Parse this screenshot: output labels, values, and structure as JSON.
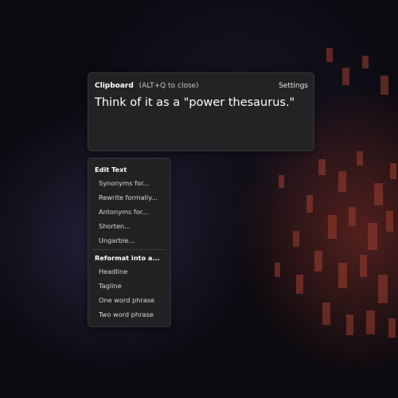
{
  "clipboard": {
    "title": "Clipboard",
    "hint": "(ALT+Q to close)",
    "settings_label": "Settings",
    "content": "Think of it as a \"power thesaurus.\""
  },
  "menu": {
    "edit_section": {
      "label": "Edit Text",
      "items": [
        "Synonyms for...",
        "Rewrite formally...",
        "Antonyms for...",
        "Shorten...",
        "Ungarble..."
      ]
    },
    "reformat_section": {
      "label": "Reformat into a...",
      "items": [
        "Headline",
        "Tagline",
        "One word phrase",
        "Two word phrase"
      ]
    }
  }
}
